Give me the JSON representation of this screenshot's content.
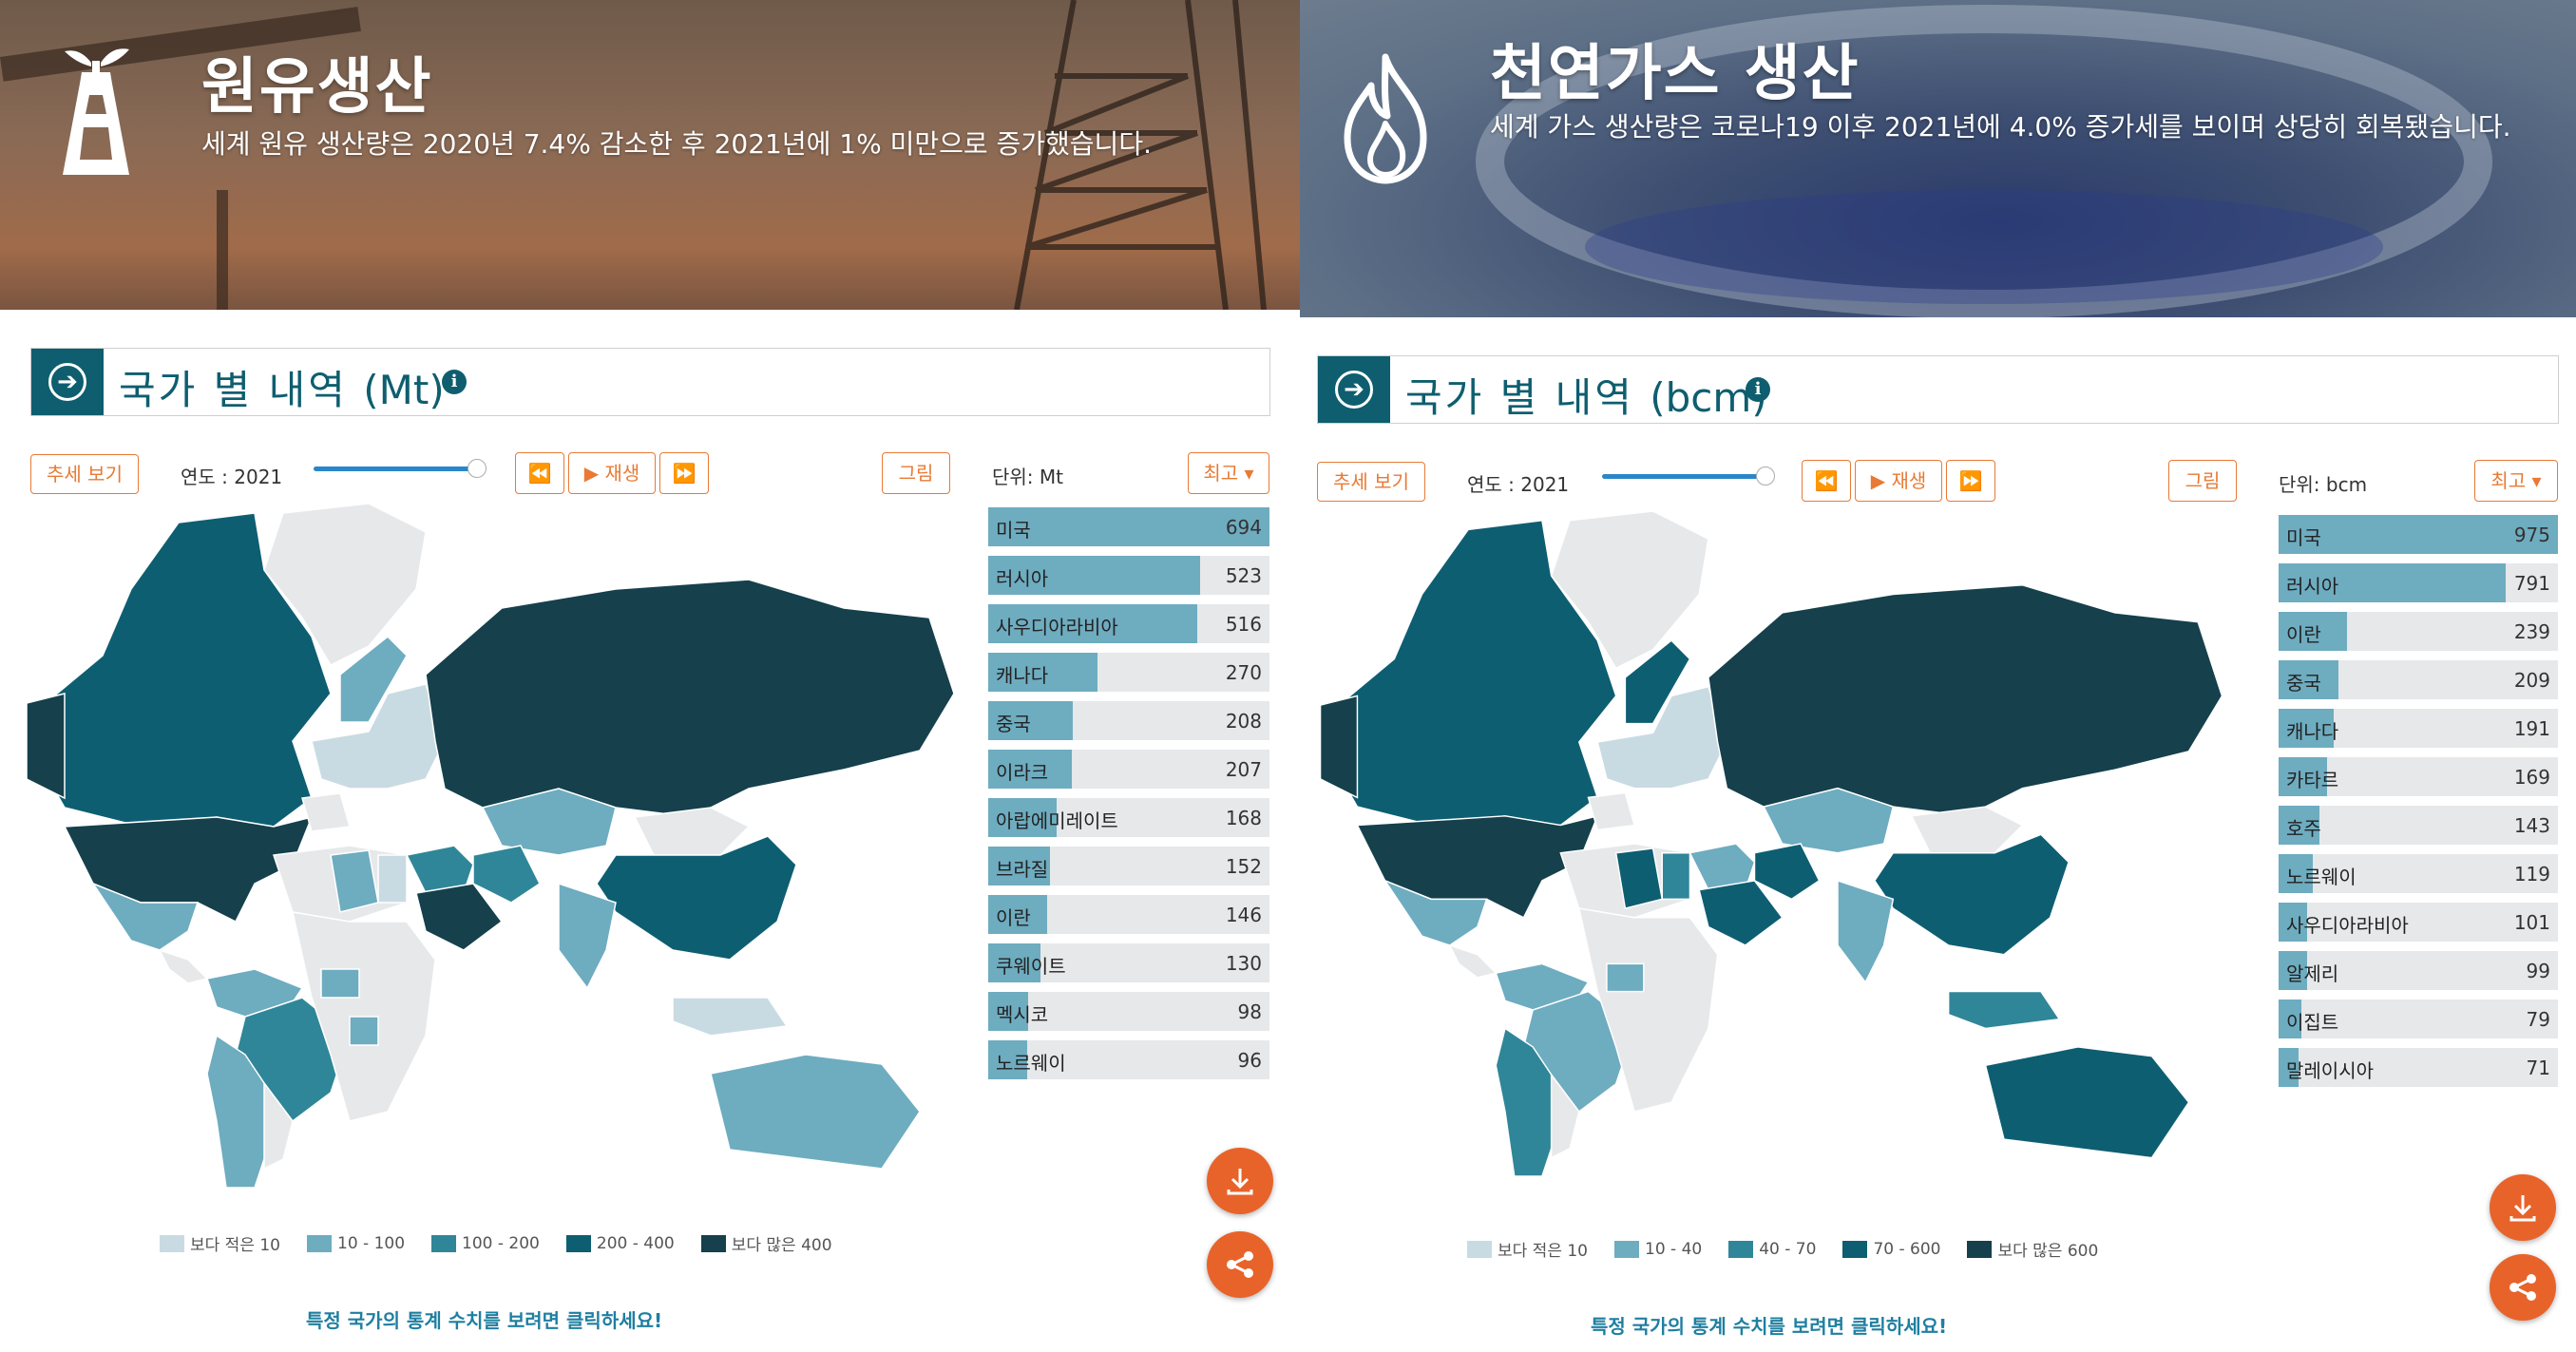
{
  "colors": {
    "accent": "#e87a35",
    "teal_dark": "#0e5e6f",
    "legend": [
      "#c9dbe2",
      "#6eacc0",
      "#2f8698",
      "#0e5e72",
      "#15404c"
    ],
    "bar_fill": "#6eacc0",
    "bar_bg": "#e6e8ea"
  },
  "left": {
    "banner": {
      "title": "원유생산",
      "subtitle": "세계 원유 생산량은 2020년 7.4% 감소한 후 2021년에 1% 미만으로 증가했습니다."
    },
    "section": {
      "title": "국가 별 내역",
      "unit": "(Mt)"
    },
    "controls": {
      "trend_button": "추세 보기",
      "year_label": "연도 : 2021",
      "play_label": "▶ 재생",
      "chart_button": "그림",
      "unit_label": "단위: Mt",
      "sort_button": "최고 ▾"
    },
    "legend": [
      "보다 적은 10",
      "10 - 100",
      "100 - 200",
      "200 - 400",
      "보다 많은 400"
    ],
    "ranking": [
      {
        "name": "미국",
        "value": 694
      },
      {
        "name": "러시아",
        "value": 523
      },
      {
        "name": "사우디아라비아",
        "value": 516
      },
      {
        "name": "캐나다",
        "value": 270
      },
      {
        "name": "중국",
        "value": 208
      },
      {
        "name": "이라크",
        "value": 207
      },
      {
        "name": "아랍에미레이트",
        "value": 168
      },
      {
        "name": "브라질",
        "value": 152
      },
      {
        "name": "이란",
        "value": 146
      },
      {
        "name": "쿠웨이트",
        "value": 130
      },
      {
        "name": "멕시코",
        "value": 98
      },
      {
        "name": "노르웨이",
        "value": 96
      }
    ],
    "hint": "특정 국가의 통계 수치를 보려면 클릭하세요!"
  },
  "right": {
    "banner": {
      "title": "천연가스 생산",
      "subtitle": "세계 가스 생산량은 코로나19 이후 2021년에 4.0% 증가세를 보이며 상당히 회복됐습니다."
    },
    "section": {
      "title": "국가 별 내역",
      "unit": "(bcm)"
    },
    "controls": {
      "trend_button": "추세 보기",
      "year_label": "연도 : 2021",
      "play_label": "▶ 재생",
      "chart_button": "그림",
      "unit_label": "단위: bcm",
      "sort_button": "최고 ▾"
    },
    "legend": [
      "보다 적은 10",
      "10 - 40",
      "40 - 70",
      "70 - 600",
      "보다 많은 600"
    ],
    "ranking": [
      {
        "name": "미국",
        "value": 975
      },
      {
        "name": "러시아",
        "value": 791
      },
      {
        "name": "이란",
        "value": 239
      },
      {
        "name": "중국",
        "value": 209
      },
      {
        "name": "캐나다",
        "value": 191
      },
      {
        "name": "카타르",
        "value": 169
      },
      {
        "name": "호주",
        "value": 143
      },
      {
        "name": "노르웨이",
        "value": 119
      },
      {
        "name": "사우디아라비아",
        "value": 101
      },
      {
        "name": "알제리",
        "value": 99
      },
      {
        "name": "이집트",
        "value": 79
      },
      {
        "name": "말레이시아",
        "value": 71
      }
    ],
    "hint": "특정 국가의 통계 수치를 보려면 클릭하세요!"
  }
}
